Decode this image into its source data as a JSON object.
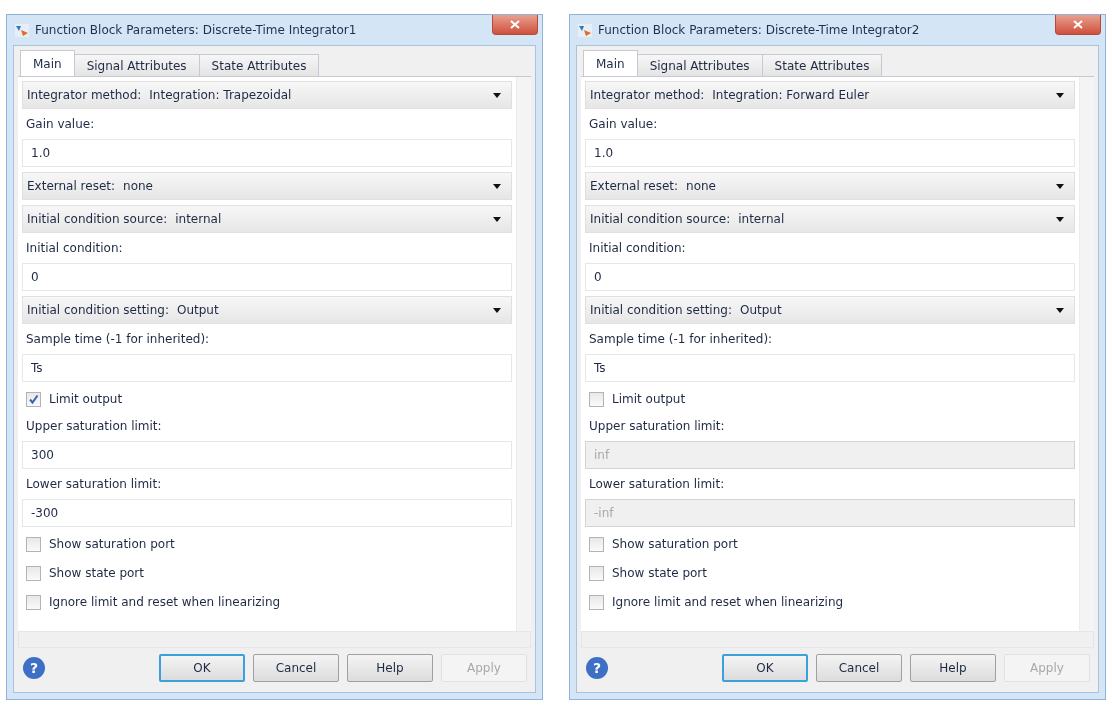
{
  "dialogs": [
    {
      "title": "Function Block Parameters: Discrete-Time Integrator1",
      "tabs": [
        {
          "label": "Main",
          "selected": true
        },
        {
          "label": "Signal Attributes",
          "selected": false
        },
        {
          "label": "State Attributes",
          "selected": false
        }
      ],
      "params": [
        {
          "kind": "select",
          "label": "Integrator method:",
          "value": "Integration: Trapezoidal"
        },
        {
          "kind": "edit",
          "label": "Gain value:",
          "value": "1.0",
          "disabled": false
        },
        {
          "kind": "select",
          "label": "External reset:",
          "value": "none"
        },
        {
          "kind": "select",
          "label": "Initial condition source:",
          "value": "internal"
        },
        {
          "kind": "edit",
          "label": "Initial condition:",
          "value": "0",
          "disabled": false
        },
        {
          "kind": "select",
          "label": "Initial condition setting:",
          "value": "Output"
        },
        {
          "kind": "edit",
          "label": "Sample time (-1 for inherited):",
          "value": "Ts",
          "disabled": false
        },
        {
          "kind": "check",
          "label": "Limit output",
          "checked": true
        },
        {
          "kind": "edit",
          "label": "Upper saturation limit:",
          "value": "300",
          "disabled": false
        },
        {
          "kind": "edit",
          "label": "Lower saturation limit:",
          "value": "-300",
          "disabled": false
        },
        {
          "kind": "check",
          "label": "Show saturation port",
          "checked": false
        },
        {
          "kind": "check",
          "label": "Show state port",
          "checked": false
        },
        {
          "kind": "check",
          "label": "Ignore limit and reset when linearizing",
          "checked": false
        }
      ],
      "help_glyph": "?",
      "buttons": [
        {
          "label": "OK",
          "default": true,
          "disabled": false
        },
        {
          "label": "Cancel",
          "default": false,
          "disabled": false
        },
        {
          "label": "Help",
          "default": false,
          "disabled": false
        },
        {
          "label": "Apply",
          "default": false,
          "disabled": true
        }
      ]
    },
    {
      "title": "Function Block Parameters: Discrete-Time Integrator2",
      "tabs": [
        {
          "label": "Main",
          "selected": true
        },
        {
          "label": "Signal Attributes",
          "selected": false
        },
        {
          "label": "State Attributes",
          "selected": false
        }
      ],
      "params": [
        {
          "kind": "select",
          "label": "Integrator method:",
          "value": "Integration: Forward Euler"
        },
        {
          "kind": "edit",
          "label": "Gain value:",
          "value": "1.0",
          "disabled": false
        },
        {
          "kind": "select",
          "label": "External reset:",
          "value": "none"
        },
        {
          "kind": "select",
          "label": "Initial condition source:",
          "value": "internal"
        },
        {
          "kind": "edit",
          "label": "Initial condition:",
          "value": "0",
          "disabled": false
        },
        {
          "kind": "select",
          "label": "Initial condition setting:",
          "value": "Output"
        },
        {
          "kind": "edit",
          "label": "Sample time (-1 for inherited):",
          "value": "Ts",
          "disabled": false
        },
        {
          "kind": "check",
          "label": "Limit output",
          "checked": false
        },
        {
          "kind": "edit",
          "label": "Upper saturation limit:",
          "value": "inf",
          "disabled": true
        },
        {
          "kind": "edit",
          "label": "Lower saturation limit:",
          "value": "-inf",
          "disabled": true
        },
        {
          "kind": "check",
          "label": "Show saturation port",
          "checked": false
        },
        {
          "kind": "check",
          "label": "Show state port",
          "checked": false
        },
        {
          "kind": "check",
          "label": "Ignore limit and reset when linearizing",
          "checked": false
        }
      ],
      "help_glyph": "?",
      "buttons": [
        {
          "label": "OK",
          "default": true,
          "disabled": false
        },
        {
          "label": "Cancel",
          "default": false,
          "disabled": false
        },
        {
          "label": "Help",
          "default": false,
          "disabled": false
        },
        {
          "label": "Apply",
          "default": false,
          "disabled": true
        }
      ]
    }
  ]
}
